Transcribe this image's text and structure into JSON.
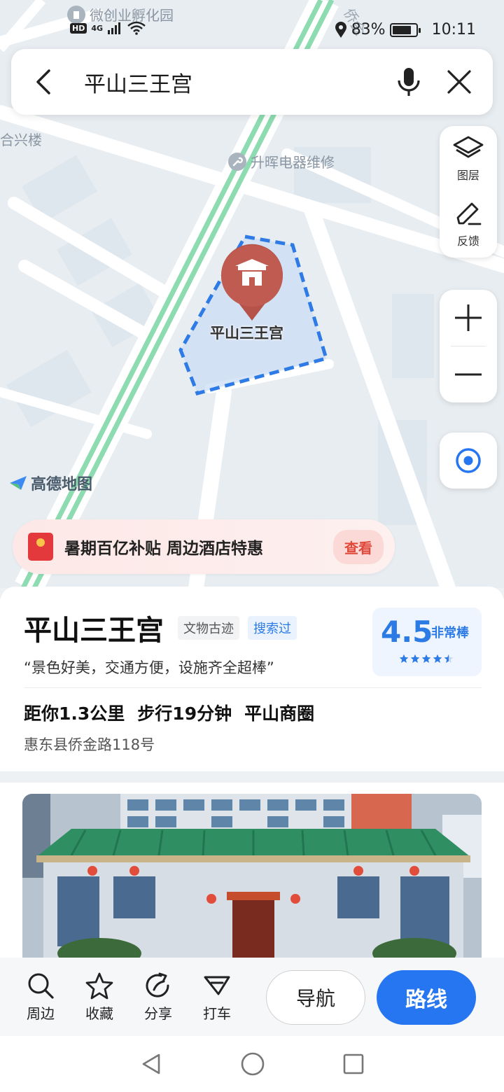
{
  "status_bar": {
    "network_badge": "HD",
    "network_type": "4G",
    "battery": "83%",
    "battery_level": 0.83,
    "time": "10:11"
  },
  "map": {
    "pois": {
      "incubator": "微创业孵化园",
      "hexinglou": "合兴楼",
      "repair_shop": "升晖电器维修"
    },
    "road_label": "侨金",
    "marker_label": "平山三王宫",
    "logo_text": "高德地图"
  },
  "search": {
    "query": "平山三王宫"
  },
  "tools": {
    "layers_label": "图层",
    "feedback_label": "反馈"
  },
  "promo": {
    "text": "暑期百亿补贴 周边酒店特惠",
    "button": "查看"
  },
  "place": {
    "name": "平山三王宫",
    "category_tag": "文物古迹",
    "searched_tag": "搜索过",
    "quote": "“景色好美，交通方便，设施齐全超棒”",
    "rating": "4.5",
    "rating_value": 4.5,
    "rating_word": "非常棒",
    "distance": "距你1.3公里",
    "walk_time": "步行19分钟",
    "district": "平山商圈",
    "address": "惠东县侨金路118号"
  },
  "actions": {
    "nearby": "周边",
    "favorite": "收藏",
    "share": "分享",
    "taxi": "打车",
    "navigate": "导航",
    "route": "路线"
  },
  "colors": {
    "primary": "#2776f1",
    "rating_blue": "#2c7be5",
    "marker_red": "#b5534a",
    "promo_red": "#e0483a",
    "road_green": "#8ddbb0"
  }
}
